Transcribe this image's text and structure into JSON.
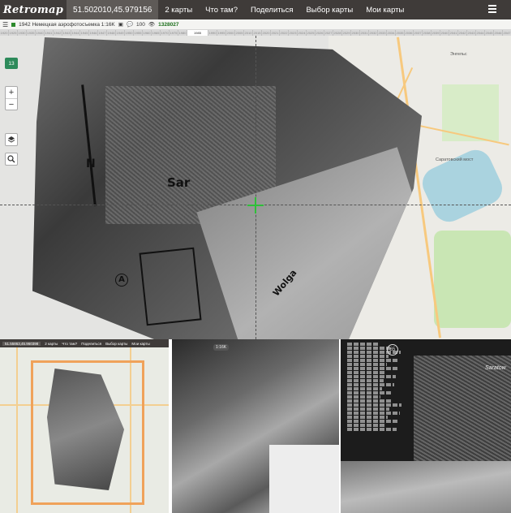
{
  "topbar": {
    "logo": "Retromap",
    "coords": "51.502010,45.979156",
    "nav": [
      "2 карты",
      "Что там?",
      "Поделиться",
      "Выбор карты",
      "Мои карты"
    ]
  },
  "subbar": {
    "map_title": "1942 Немецкая аэрофотосъемка 1:16K",
    "comments": "100",
    "views": "1328027"
  },
  "timeline": {
    "ticks": [
      "1920",
      "1925",
      "1930",
      "1935",
      "1940",
      "1941",
      "1942",
      "1943",
      "1944",
      "1945",
      "1946",
      "1947",
      "1948",
      "1949",
      "1950",
      "1955",
      "1960",
      "1965",
      "1970",
      "1975",
      "1980",
      "1985",
      "1990",
      "1995",
      "2000",
      "2005",
      "2010",
      "2015",
      "2020",
      "2021",
      "2022",
      "2023",
      "2024",
      "2025",
      "2026",
      "2027",
      "2028",
      "2029",
      "2030",
      "2031",
      "2032",
      "2033",
      "2034",
      "2035",
      "2036",
      "2037",
      "2038",
      "2039",
      "2040",
      "2041",
      "2042",
      "2043",
      "2044",
      "2045",
      "2046",
      "2047"
    ],
    "active_index": 21
  },
  "map": {
    "zoom": "13",
    "zoom_in": "+",
    "zoom_out": "−",
    "text_sar": "Sar",
    "text_wolga": "Wolga",
    "text_n": "N",
    "text_a": "A",
    "osm_labels": [
      "Саратовский мост",
      "Энгельс"
    ]
  },
  "panel1": {
    "coords": "51.55863,45.960398",
    "nav": [
      "2 карты",
      "Что там?",
      "Поделиться",
      "Выбор карты",
      "Мои карты"
    ]
  },
  "panel2": {
    "badge": "1:16K"
  },
  "panel3": {
    "badge": "65",
    "label": "Saratow"
  },
  "colors": {
    "topbar": "#3f3b39",
    "accent_green": "#2d8a5a",
    "crosshair": "#2fbf3a",
    "selection_orange": "#f0a25a"
  }
}
